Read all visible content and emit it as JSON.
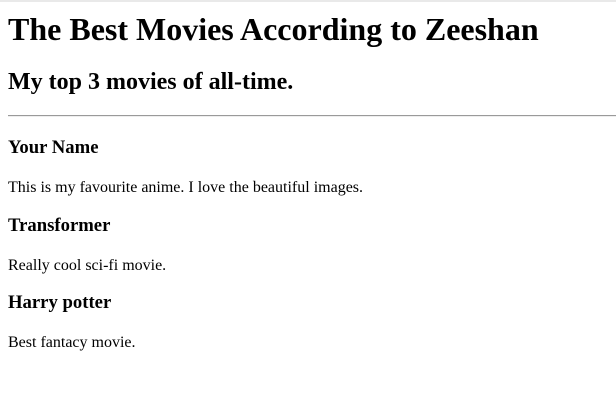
{
  "page": {
    "title": "The Best Movies According to Zeeshan",
    "subtitle": "My top 3 movies of all-time."
  },
  "movies": [
    {
      "title": "Your Name",
      "description": "This is my favourite anime. I love the beautiful images."
    },
    {
      "title": "Transformer",
      "description": "Really cool sci-fi movie."
    },
    {
      "title": "Harry potter",
      "description": "Best fantacy movie."
    }
  ]
}
